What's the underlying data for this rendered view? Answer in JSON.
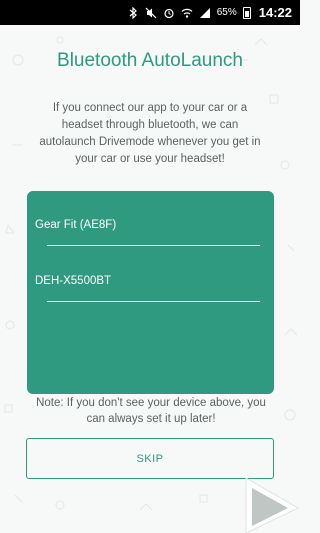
{
  "status_bar": {
    "battery": "65%",
    "time": "14:22",
    "icons": [
      "bluetooth-icon",
      "mute-icon",
      "alarm-icon",
      "wifi-icon",
      "signal-icon",
      "battery-icon"
    ]
  },
  "header": {
    "title": "Bluetooth AutoLaunch"
  },
  "description": "If you connect our app to your car or a headset through bluetooth, we can autolaunch Drivemode whenever you get in your car or use your headset!",
  "devices": [
    {
      "name": "Gear Fit (AE8F)"
    },
    {
      "name": "DEH-X5500BT"
    }
  ],
  "note": "Note: If you don't see your device above, you can always set it up later!",
  "actions": {
    "skip_label": "SKIP"
  },
  "colors": {
    "accent": "#2f9a7f",
    "background": "#f7f8f8",
    "text": "#5c6360"
  }
}
